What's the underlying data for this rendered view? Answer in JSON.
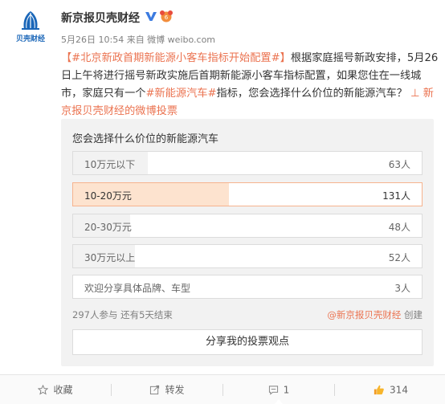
{
  "post": {
    "author": "新京报贝壳财经",
    "avatar_text": "贝壳财经",
    "meta": "5月26日 10:54 来自 微博 weibo.com",
    "text": {
      "line1_topic": "【#北京新政首期新能源小客车指标开始配置#】",
      "line1_rest": "根据家庭摇号新政安排，5月26",
      "line2": "日上午将进行摇号新政实施后首期新能源小客车指标配置，如果您住在一线城",
      "line3_a": "市，家庭只有一个",
      "line3_topic": "#新能源汽车#",
      "line3_b": "指标，您会选择什么价位的新能源汽车？",
      "line3_link": "⊥ 新",
      "line4_link": "京报贝壳财经的微博投票"
    }
  },
  "poll": {
    "title": "您会选择什么价位的新能源汽车",
    "options": [
      {
        "label": "10万元以下",
        "count": "63人",
        "votes": 63,
        "selected": false
      },
      {
        "label": "10-20万元",
        "count": "131人",
        "votes": 131,
        "selected": true
      },
      {
        "label": "20-30万元",
        "count": "48人",
        "votes": 48,
        "selected": false
      },
      {
        "label": "30万元以上",
        "count": "52人",
        "votes": 52,
        "selected": false
      }
    ],
    "free_option": {
      "label": "欢迎分享具体品牌、车型",
      "count": "3人"
    },
    "participants": "297人参与 还有5天结束",
    "creator_link": "@新京报贝壳财经",
    "creator_suffix": " 创建",
    "share_button": "分享我的投票观点"
  },
  "actions": {
    "favorite": "收藏",
    "repost": "转发",
    "comment": "1",
    "like": "314"
  },
  "colors": {
    "accent": "#eb7350",
    "brand_blue": "#1a66b8",
    "selected_fill": "#fde3cf"
  }
}
